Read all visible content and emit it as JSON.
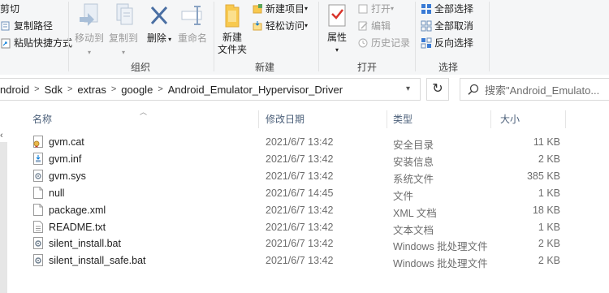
{
  "ribbon": {
    "clipboard": {
      "cut": "剪切",
      "copy_path": "复制路径",
      "paste_shortcut": "粘贴快捷方式"
    },
    "organize": {
      "move_to": "移动到",
      "copy_to": "复制到",
      "delete": "删除",
      "rename": "重命名",
      "label": "组织"
    },
    "new": {
      "new_folder_line1": "新建",
      "new_folder_line2": "文件夹",
      "new_item": "新建项目",
      "easy_access": "轻松访问",
      "label": "新建"
    },
    "open": {
      "properties": "属性",
      "open": "打开",
      "edit": "编辑",
      "history": "历史记录",
      "label": "打开"
    },
    "select": {
      "select_all": "全部选择",
      "select_none": "全部取消",
      "invert": "反向选择",
      "label": "选择"
    }
  },
  "address": {
    "crumbs": [
      "ndroid",
      "Sdk",
      "extras",
      "google",
      "Android_Emulator_Hypervisor_Driver"
    ],
    "refresh_symbol": "↻",
    "search_placeholder": "搜索\"Android_Emulato..."
  },
  "columns": {
    "name": "名称",
    "date": "修改日期",
    "type": "类型",
    "size": "大小"
  },
  "files": [
    {
      "name": "gvm.cat",
      "date": "2021/6/7 13:42",
      "type": "安全目录",
      "size": "11 KB",
      "icon": "catalog-file-icon"
    },
    {
      "name": "gvm.inf",
      "date": "2021/6/7 13:42",
      "type": "安装信息",
      "size": "2 KB",
      "icon": "setup-info-file-icon"
    },
    {
      "name": "gvm.sys",
      "date": "2021/6/7 13:42",
      "type": "系统文件",
      "size": "385 KB",
      "icon": "system-file-icon"
    },
    {
      "name": "null",
      "date": "2021/6/7 14:45",
      "type": "文件",
      "size": "1 KB",
      "icon": "blank-file-icon"
    },
    {
      "name": "package.xml",
      "date": "2021/6/7 13:42",
      "type": "XML 文档",
      "size": "18 KB",
      "icon": "xml-file-icon"
    },
    {
      "name": "README.txt",
      "date": "2021/6/7 13:42",
      "type": "文本文档",
      "size": "1 KB",
      "icon": "text-file-icon"
    },
    {
      "name": "silent_install.bat",
      "date": "2021/6/7 13:42",
      "type": "Windows 批处理文件",
      "size": "2 KB",
      "icon": "batch-file-icon"
    },
    {
      "name": "silent_install_safe.bat",
      "date": "2021/6/7 13:42",
      "type": "Windows 批处理文件",
      "size": "2 KB",
      "icon": "batch-file-icon"
    }
  ],
  "colors": {
    "accent": "#0078d7",
    "header_text": "#4c607a",
    "folder": "#f8c94e"
  }
}
